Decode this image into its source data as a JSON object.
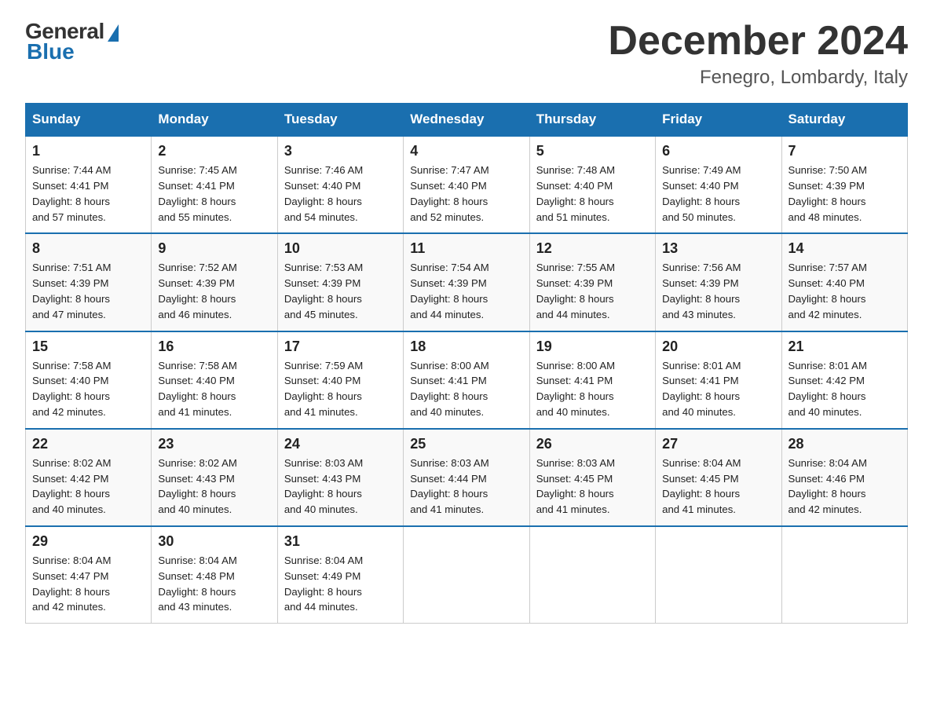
{
  "header": {
    "logo": {
      "general": "General",
      "blue": "Blue"
    },
    "title": "December 2024",
    "location": "Fenegro, Lombardy, Italy"
  },
  "days_of_week": [
    "Sunday",
    "Monday",
    "Tuesday",
    "Wednesday",
    "Thursday",
    "Friday",
    "Saturday"
  ],
  "weeks": [
    [
      {
        "day": "1",
        "sunrise": "7:44 AM",
        "sunset": "4:41 PM",
        "daylight": "8 hours and 57 minutes."
      },
      {
        "day": "2",
        "sunrise": "7:45 AM",
        "sunset": "4:41 PM",
        "daylight": "8 hours and 55 minutes."
      },
      {
        "day": "3",
        "sunrise": "7:46 AM",
        "sunset": "4:40 PM",
        "daylight": "8 hours and 54 minutes."
      },
      {
        "day": "4",
        "sunrise": "7:47 AM",
        "sunset": "4:40 PM",
        "daylight": "8 hours and 52 minutes."
      },
      {
        "day": "5",
        "sunrise": "7:48 AM",
        "sunset": "4:40 PM",
        "daylight": "8 hours and 51 minutes."
      },
      {
        "day": "6",
        "sunrise": "7:49 AM",
        "sunset": "4:40 PM",
        "daylight": "8 hours and 50 minutes."
      },
      {
        "day": "7",
        "sunrise": "7:50 AM",
        "sunset": "4:39 PM",
        "daylight": "8 hours and 48 minutes."
      }
    ],
    [
      {
        "day": "8",
        "sunrise": "7:51 AM",
        "sunset": "4:39 PM",
        "daylight": "8 hours and 47 minutes."
      },
      {
        "day": "9",
        "sunrise": "7:52 AM",
        "sunset": "4:39 PM",
        "daylight": "8 hours and 46 minutes."
      },
      {
        "day": "10",
        "sunrise": "7:53 AM",
        "sunset": "4:39 PM",
        "daylight": "8 hours and 45 minutes."
      },
      {
        "day": "11",
        "sunrise": "7:54 AM",
        "sunset": "4:39 PM",
        "daylight": "8 hours and 44 minutes."
      },
      {
        "day": "12",
        "sunrise": "7:55 AM",
        "sunset": "4:39 PM",
        "daylight": "8 hours and 44 minutes."
      },
      {
        "day": "13",
        "sunrise": "7:56 AM",
        "sunset": "4:39 PM",
        "daylight": "8 hours and 43 minutes."
      },
      {
        "day": "14",
        "sunrise": "7:57 AM",
        "sunset": "4:40 PM",
        "daylight": "8 hours and 42 minutes."
      }
    ],
    [
      {
        "day": "15",
        "sunrise": "7:58 AM",
        "sunset": "4:40 PM",
        "daylight": "8 hours and 42 minutes."
      },
      {
        "day": "16",
        "sunrise": "7:58 AM",
        "sunset": "4:40 PM",
        "daylight": "8 hours and 41 minutes."
      },
      {
        "day": "17",
        "sunrise": "7:59 AM",
        "sunset": "4:40 PM",
        "daylight": "8 hours and 41 minutes."
      },
      {
        "day": "18",
        "sunrise": "8:00 AM",
        "sunset": "4:41 PM",
        "daylight": "8 hours and 40 minutes."
      },
      {
        "day": "19",
        "sunrise": "8:00 AM",
        "sunset": "4:41 PM",
        "daylight": "8 hours and 40 minutes."
      },
      {
        "day": "20",
        "sunrise": "8:01 AM",
        "sunset": "4:41 PM",
        "daylight": "8 hours and 40 minutes."
      },
      {
        "day": "21",
        "sunrise": "8:01 AM",
        "sunset": "4:42 PM",
        "daylight": "8 hours and 40 minutes."
      }
    ],
    [
      {
        "day": "22",
        "sunrise": "8:02 AM",
        "sunset": "4:42 PM",
        "daylight": "8 hours and 40 minutes."
      },
      {
        "day": "23",
        "sunrise": "8:02 AM",
        "sunset": "4:43 PM",
        "daylight": "8 hours and 40 minutes."
      },
      {
        "day": "24",
        "sunrise": "8:03 AM",
        "sunset": "4:43 PM",
        "daylight": "8 hours and 40 minutes."
      },
      {
        "day": "25",
        "sunrise": "8:03 AM",
        "sunset": "4:44 PM",
        "daylight": "8 hours and 41 minutes."
      },
      {
        "day": "26",
        "sunrise": "8:03 AM",
        "sunset": "4:45 PM",
        "daylight": "8 hours and 41 minutes."
      },
      {
        "day": "27",
        "sunrise": "8:04 AM",
        "sunset": "4:45 PM",
        "daylight": "8 hours and 41 minutes."
      },
      {
        "day": "28",
        "sunrise": "8:04 AM",
        "sunset": "4:46 PM",
        "daylight": "8 hours and 42 minutes."
      }
    ],
    [
      {
        "day": "29",
        "sunrise": "8:04 AM",
        "sunset": "4:47 PM",
        "daylight": "8 hours and 42 minutes."
      },
      {
        "day": "30",
        "sunrise": "8:04 AM",
        "sunset": "4:48 PM",
        "daylight": "8 hours and 43 minutes."
      },
      {
        "day": "31",
        "sunrise": "8:04 AM",
        "sunset": "4:49 PM",
        "daylight": "8 hours and 44 minutes."
      },
      null,
      null,
      null,
      null
    ]
  ],
  "labels": {
    "sunrise": "Sunrise:",
    "sunset": "Sunset:",
    "daylight": "Daylight:"
  }
}
